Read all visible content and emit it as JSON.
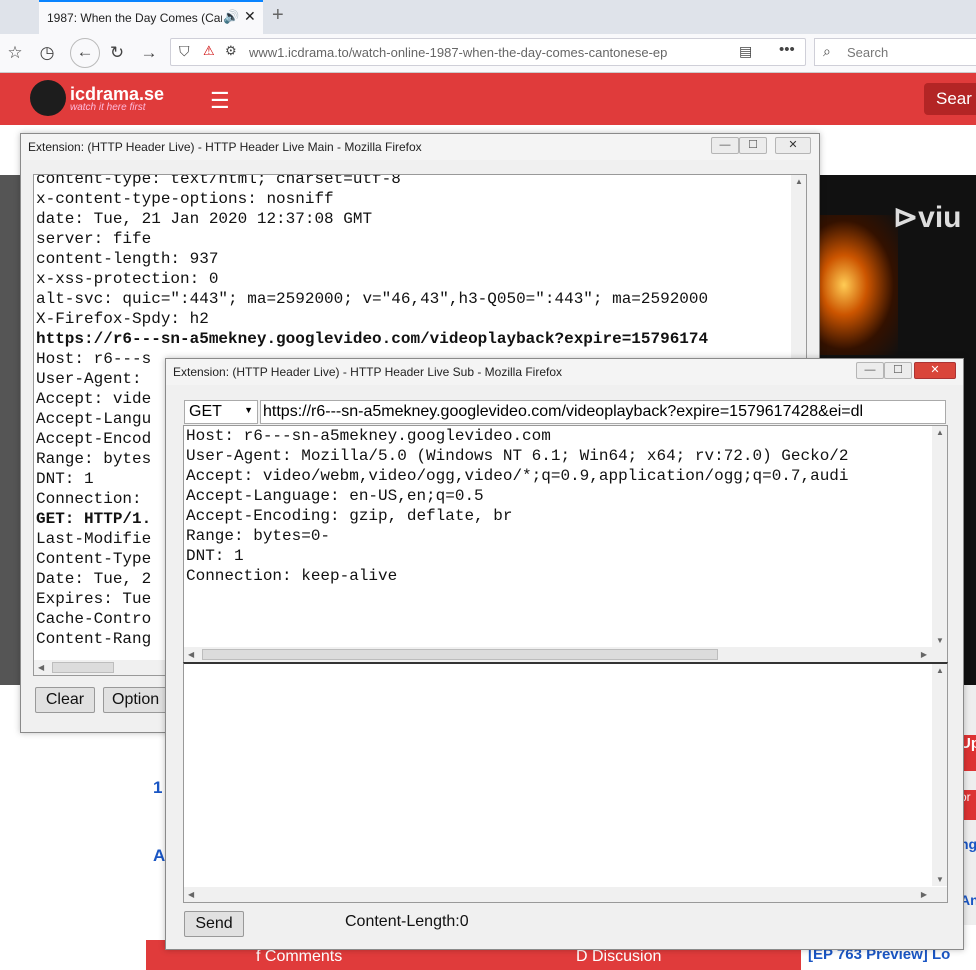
{
  "browser": {
    "tab_title": "1987: When the Day Comes (Car",
    "url": "www1.icdrama.to/watch-online-1987-when-the-day-comes-cantonese-ep",
    "search_placeholder": "Search",
    "icons": [
      "library-icon",
      "history-icon",
      "back-icon",
      "reload-icon",
      "forward-icon",
      "shield-icon",
      "reader-icon",
      "more-icon",
      "search-icon"
    ]
  },
  "site": {
    "logo_name": "icdrama.se",
    "logo_tagline": "watch it here first",
    "search_button": "Sear",
    "side_text_up": "Up",
    "side_text_2": "or",
    "side_text_3": "ng",
    "side_text_4": "An",
    "num_1": "1",
    "num_a": "A",
    "bottom_comments": "Comments",
    "bottom_discussion": "Discusion",
    "bottom_link": "[EP 763 Preview] Lo",
    "video_brand": "viu",
    "brand_color": "#e03b3b"
  },
  "main_window": {
    "title": "Extension: (HTTP Header Live) - HTTP Header Live Main - Mozilla Firefox",
    "lines": [
      {
        "text": "content-type: text/html; charset=utf-8",
        "bold": false
      },
      {
        "text": "x-content-type-options: nosniff",
        "bold": false
      },
      {
        "text": "date: Tue, 21 Jan 2020 12:37:08 GMT",
        "bold": false
      },
      {
        "text": "server: fife",
        "bold": false
      },
      {
        "text": "content-length: 937",
        "bold": false
      },
      {
        "text": "x-xss-protection: 0",
        "bold": false
      },
      {
        "text": "alt-svc: quic=\":443\"; ma=2592000; v=\"46,43\",h3-Q050=\":443\"; ma=2592000",
        "bold": false
      },
      {
        "text": "X-Firefox-Spdy: h2",
        "bold": false
      },
      {
        "text": "https://r6---sn-a5mekney.googlevideo.com/videoplayback?expire=15796174",
        "bold": true
      },
      {
        "text": "Host: r6---s",
        "bold": false
      },
      {
        "text": "User-Agent: ",
        "bold": false
      },
      {
        "text": "Accept: vide",
        "bold": false
      },
      {
        "text": "Accept-Langu",
        "bold": false
      },
      {
        "text": "Accept-Encod",
        "bold": false
      },
      {
        "text": "Range: bytes",
        "bold": false
      },
      {
        "text": "DNT: 1",
        "bold": false
      },
      {
        "text": "Connection: ",
        "bold": false
      },
      {
        "text": "GET: HTTP/1.",
        "bold": true
      },
      {
        "text": "Last-Modifie",
        "bold": false
      },
      {
        "text": "Content-Type",
        "bold": false
      },
      {
        "text": "Date: Tue, 2",
        "bold": false
      },
      {
        "text": "Expires: Tue",
        "bold": false
      },
      {
        "text": "Cache-Contro",
        "bold": false
      },
      {
        "text": "Content-Rang",
        "bold": false
      }
    ],
    "clear_label": "Clear",
    "options_label": "Option"
  },
  "sub_window": {
    "title": "Extension: (HTTP Header Live) - HTTP Header Live Sub - Mozilla Firefox",
    "method": "GET",
    "request_url": "https://r6---sn-a5mekney.googlevideo.com/videoplayback?expire=1579617428&ei=dl",
    "headers": [
      "Host: r6---sn-a5mekney.googlevideo.com",
      "User-Agent: Mozilla/5.0 (Windows NT 6.1; Win64; x64; rv:72.0) Gecko/2",
      "Accept: video/webm,video/ogg,video/*;q=0.9,application/ogg;q=0.7,audi",
      "Accept-Language: en-US,en;q=0.5",
      "Accept-Encoding: gzip, deflate, br",
      "Range: bytes=0-",
      "DNT: 1",
      "Connection: keep-alive"
    ],
    "body": "",
    "send_label": "Send",
    "content_length": "Content-Length:0"
  }
}
